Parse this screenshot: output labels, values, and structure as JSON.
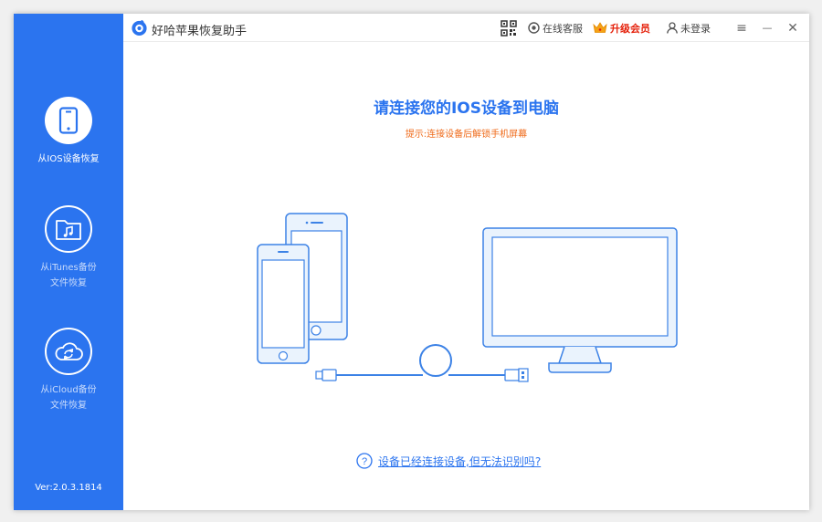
{
  "app": {
    "title": "好哈苹果恢复助手",
    "version": "Ver:2.0.3.1814"
  },
  "titlebar": {
    "qr_icon": "qr-code-icon",
    "support_label": "在线客服",
    "vip_label": "升级会员",
    "login_label": "未登录",
    "menu_symbol": "≡",
    "minimize_symbol": "—",
    "close_symbol": "✕"
  },
  "sidebar": {
    "items": [
      {
        "label": "从IOS设备恢复",
        "icon": "phone-icon",
        "active": true
      },
      {
        "label": "从iTunes备份\n文件恢复",
        "icon": "music-folder-icon",
        "active": false
      },
      {
        "label": "从iCloud备份\n文件恢复",
        "icon": "cloud-sync-icon",
        "active": false
      }
    ]
  },
  "main": {
    "heading": "请连接您的IOS设备到电脑",
    "hint": "提示:连接设备后解锁手机屏幕",
    "help_link": "设备已经连接设备,但无法识别吗?"
  },
  "colors": {
    "brand_blue": "#2b74ef",
    "hint_orange": "#ef6a19",
    "vip_red": "#e5220c",
    "illustration_fill": "#eaf3fd",
    "illustration_stroke": "#3c82e6"
  }
}
